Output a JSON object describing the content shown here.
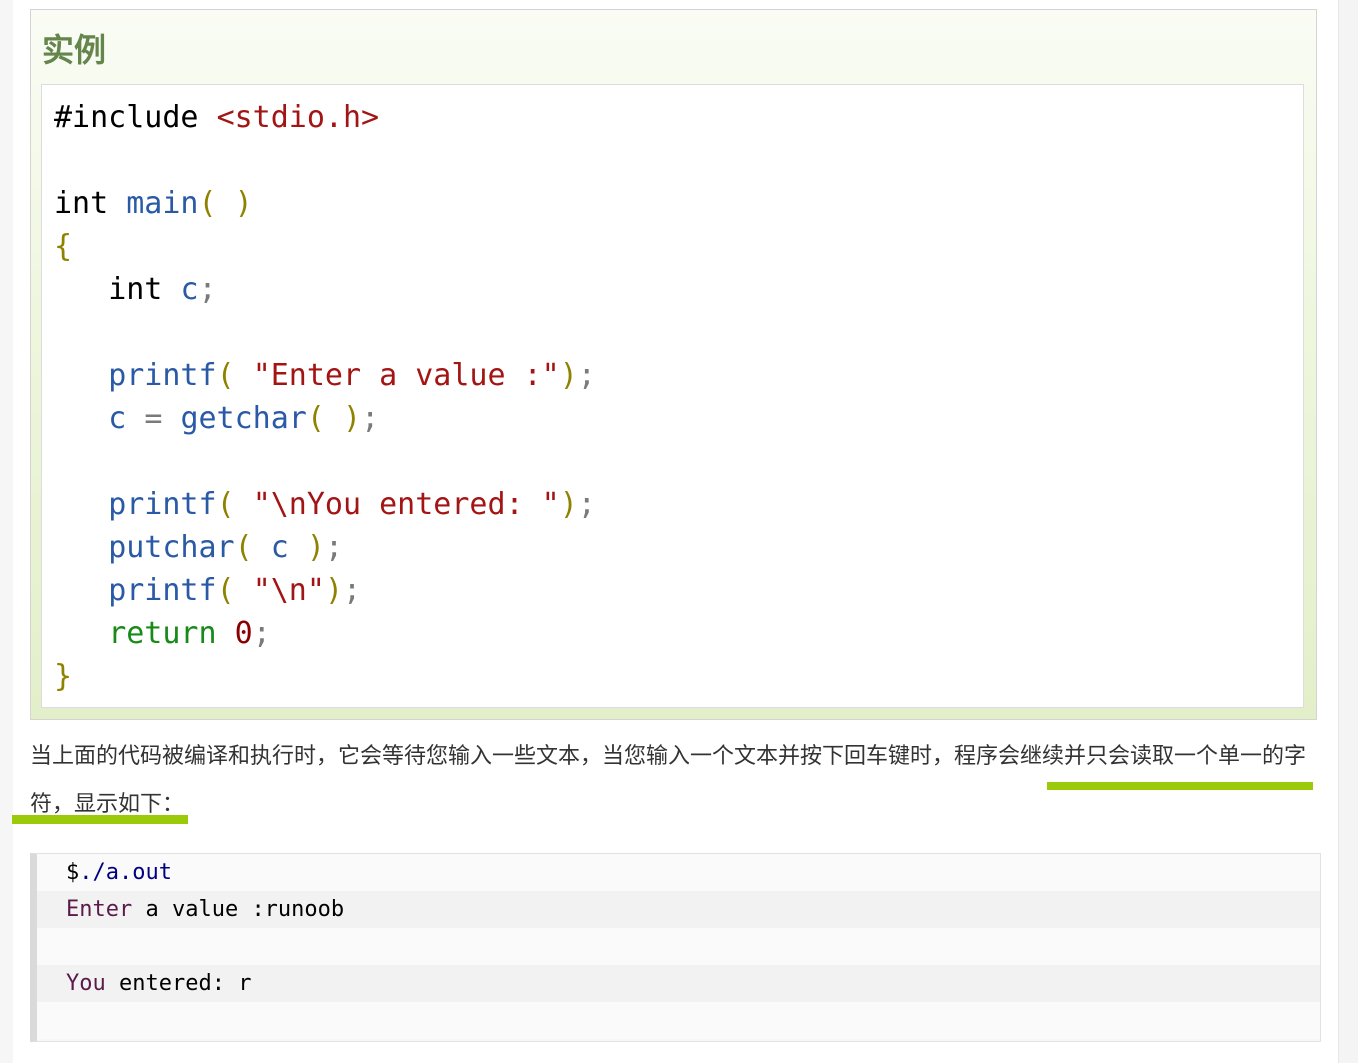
{
  "example": {
    "title": "实例"
  },
  "code": {
    "line1": {
      "directive": "#include",
      "header": "<stdio.h>"
    },
    "line3": {
      "type": "int",
      "name": "main",
      "open": "(",
      "close": ")"
    },
    "line4": {
      "brace": "{"
    },
    "line5": {
      "type": "int",
      "var": "c",
      "semi": ";"
    },
    "line7": {
      "fn": "printf",
      "open": "(",
      "str": "\"Enter a value :\"",
      "close": ")",
      "semi": ";"
    },
    "line8": {
      "var": "c",
      "op": "=",
      "fn": "getchar",
      "open": "(",
      "close": ")",
      "semi": ";"
    },
    "line10": {
      "fn": "printf",
      "open": "(",
      "str": "\"\\nYou entered: \"",
      "close": ")",
      "semi": ";"
    },
    "line11": {
      "fn": "putchar",
      "open": "(",
      "arg": "c",
      "close": ")",
      "semi": ";"
    },
    "line12": {
      "fn": "printf",
      "open": "(",
      "str": "\"\\n\"",
      "close": ")",
      "semi": ";"
    },
    "line13": {
      "kw": "return",
      "num": "0",
      "semi": ";"
    },
    "line14": {
      "brace": "}"
    }
  },
  "description": {
    "text": "当上面的代码被编译和执行时，它会等待您输入一些文本，当您输入一个文本并按下回车键时，程序会继续并只会读取一个单一的字符，显示如下："
  },
  "terminal": {
    "line1": {
      "prompt": "$",
      "cmd": "./a.out"
    },
    "line2": {
      "a": "Enter",
      "b": " a value :runoob"
    },
    "line3": "",
    "line4": {
      "a": "You",
      "b": " entered: r"
    }
  },
  "colors": {
    "title": "#64854c",
    "highlight": "#9bca0a",
    "function": "#2a5aa6",
    "string": "#a31515",
    "paren": "#8e8200",
    "return": "#178a17"
  }
}
